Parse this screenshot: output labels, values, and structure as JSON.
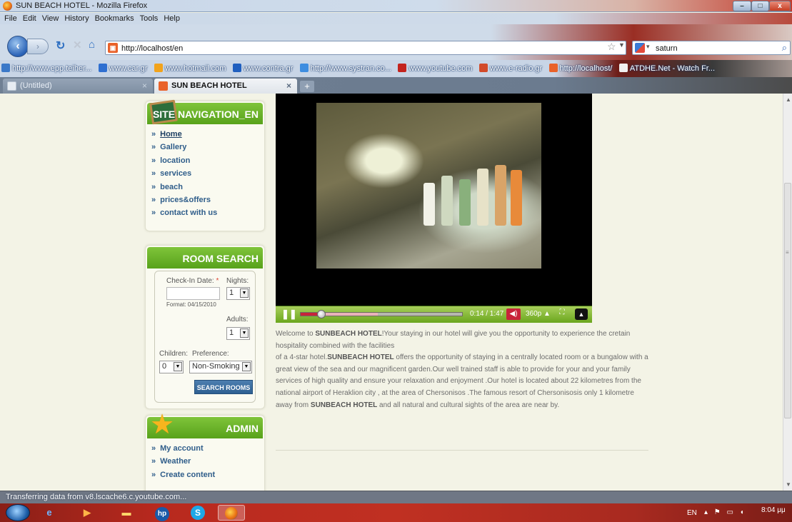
{
  "window": {
    "title": "SUN BEACH HOTEL - Mozilla Firefox",
    "min": "–",
    "max": "□",
    "close": "x"
  },
  "menu": [
    "File",
    "Edit",
    "View",
    "History",
    "Bookmarks",
    "Tools",
    "Help"
  ],
  "navbar": {
    "url": "http://localhost/en",
    "search_value": "saturn"
  },
  "bookmarks": [
    {
      "label": "http://www.epp.teiher...",
      "color": "#3a78c8"
    },
    {
      "label": "www.car.gr",
      "color": "#2f6fd0"
    },
    {
      "label": "www.hotmail.com",
      "color": "#f2a31b"
    },
    {
      "label": "www.contra.gr",
      "color": "#1f5fbf"
    },
    {
      "label": "http://www.systran.co...",
      "color": "#3d8de0"
    },
    {
      "label": "www.youtube.com",
      "color": "#c3231d"
    },
    {
      "label": "www.e-radio.gr",
      "color": "#d24a2a"
    },
    {
      "label": "http://localhost/",
      "color": "#e9622a"
    },
    {
      "label": "ATDHE.Net - Watch Fr...",
      "color": "#f0f0f0"
    }
  ],
  "tabs": [
    {
      "label": "(Untitled)"
    },
    {
      "label": "SUN BEACH HOTEL"
    }
  ],
  "site_nav": {
    "title": "SITE NAVIGATION_EN",
    "items": [
      "Home",
      "Gallery",
      "location",
      "services",
      "beach",
      "prices&offers",
      "contact with us"
    ]
  },
  "room_search": {
    "title": "ROOM SEARCH",
    "checkin_label": "Check-In Date:",
    "required_mark": "*",
    "format_hint": "Format: 04/15/2010",
    "nights_label": "Nights:",
    "nights_value": "1",
    "adults_label": "Adults:",
    "adults_value": "1",
    "children_label": "Children:",
    "children_value": "0",
    "preference_label": "Preference:",
    "preference_value": "Non-Smoking",
    "button": "SEARCH ROOMS"
  },
  "admin": {
    "title": "ADMIN",
    "items": [
      "My account",
      "Weather",
      "Create content"
    ]
  },
  "video": {
    "time": "0:14 / 1:47",
    "quality": "360p",
    "progress_fraction": 0.13,
    "buffered_fraction": 0.48
  },
  "welcome": {
    "intro": "Welcome  to ",
    "hotel_1": "SUNBEACH HOTEL",
    "line1": "!Your staying in our hotel will give you the opportunity to experience the cretain hospitality combined with the facilities",
    "line2_pre": "of a 4-star  hotel.",
    "hotel_2": "SUNBEACH HOTEL",
    "line2_post": " offers the opportunity of staying in a  centrally located room or a bungalow with a great view of the sea and our magnificent garden.Our well trained staff is able to provide for your and your family services of high quality and ensure your relaxation and enjoyment .Our hotel is located about 22 kilometres from the  national airport of Heraklion city , at the area of Chersonisos .The famous resort of Chersonisosis only 1 kilometre away from ",
    "hotel_3": "SUNBEACH HOTEL",
    "line3": "  and all natural and cultural sights of the area are near by."
  },
  "status": "Transferring data from v8.lscache6.c.youtube.com...",
  "taskbar": {
    "lang": "EN",
    "time": "8:04 μμ"
  },
  "colors": {
    "accent_green": "#6ab12a",
    "link_blue": "#2f5d8a",
    "taskbar_red": "#c03022"
  }
}
